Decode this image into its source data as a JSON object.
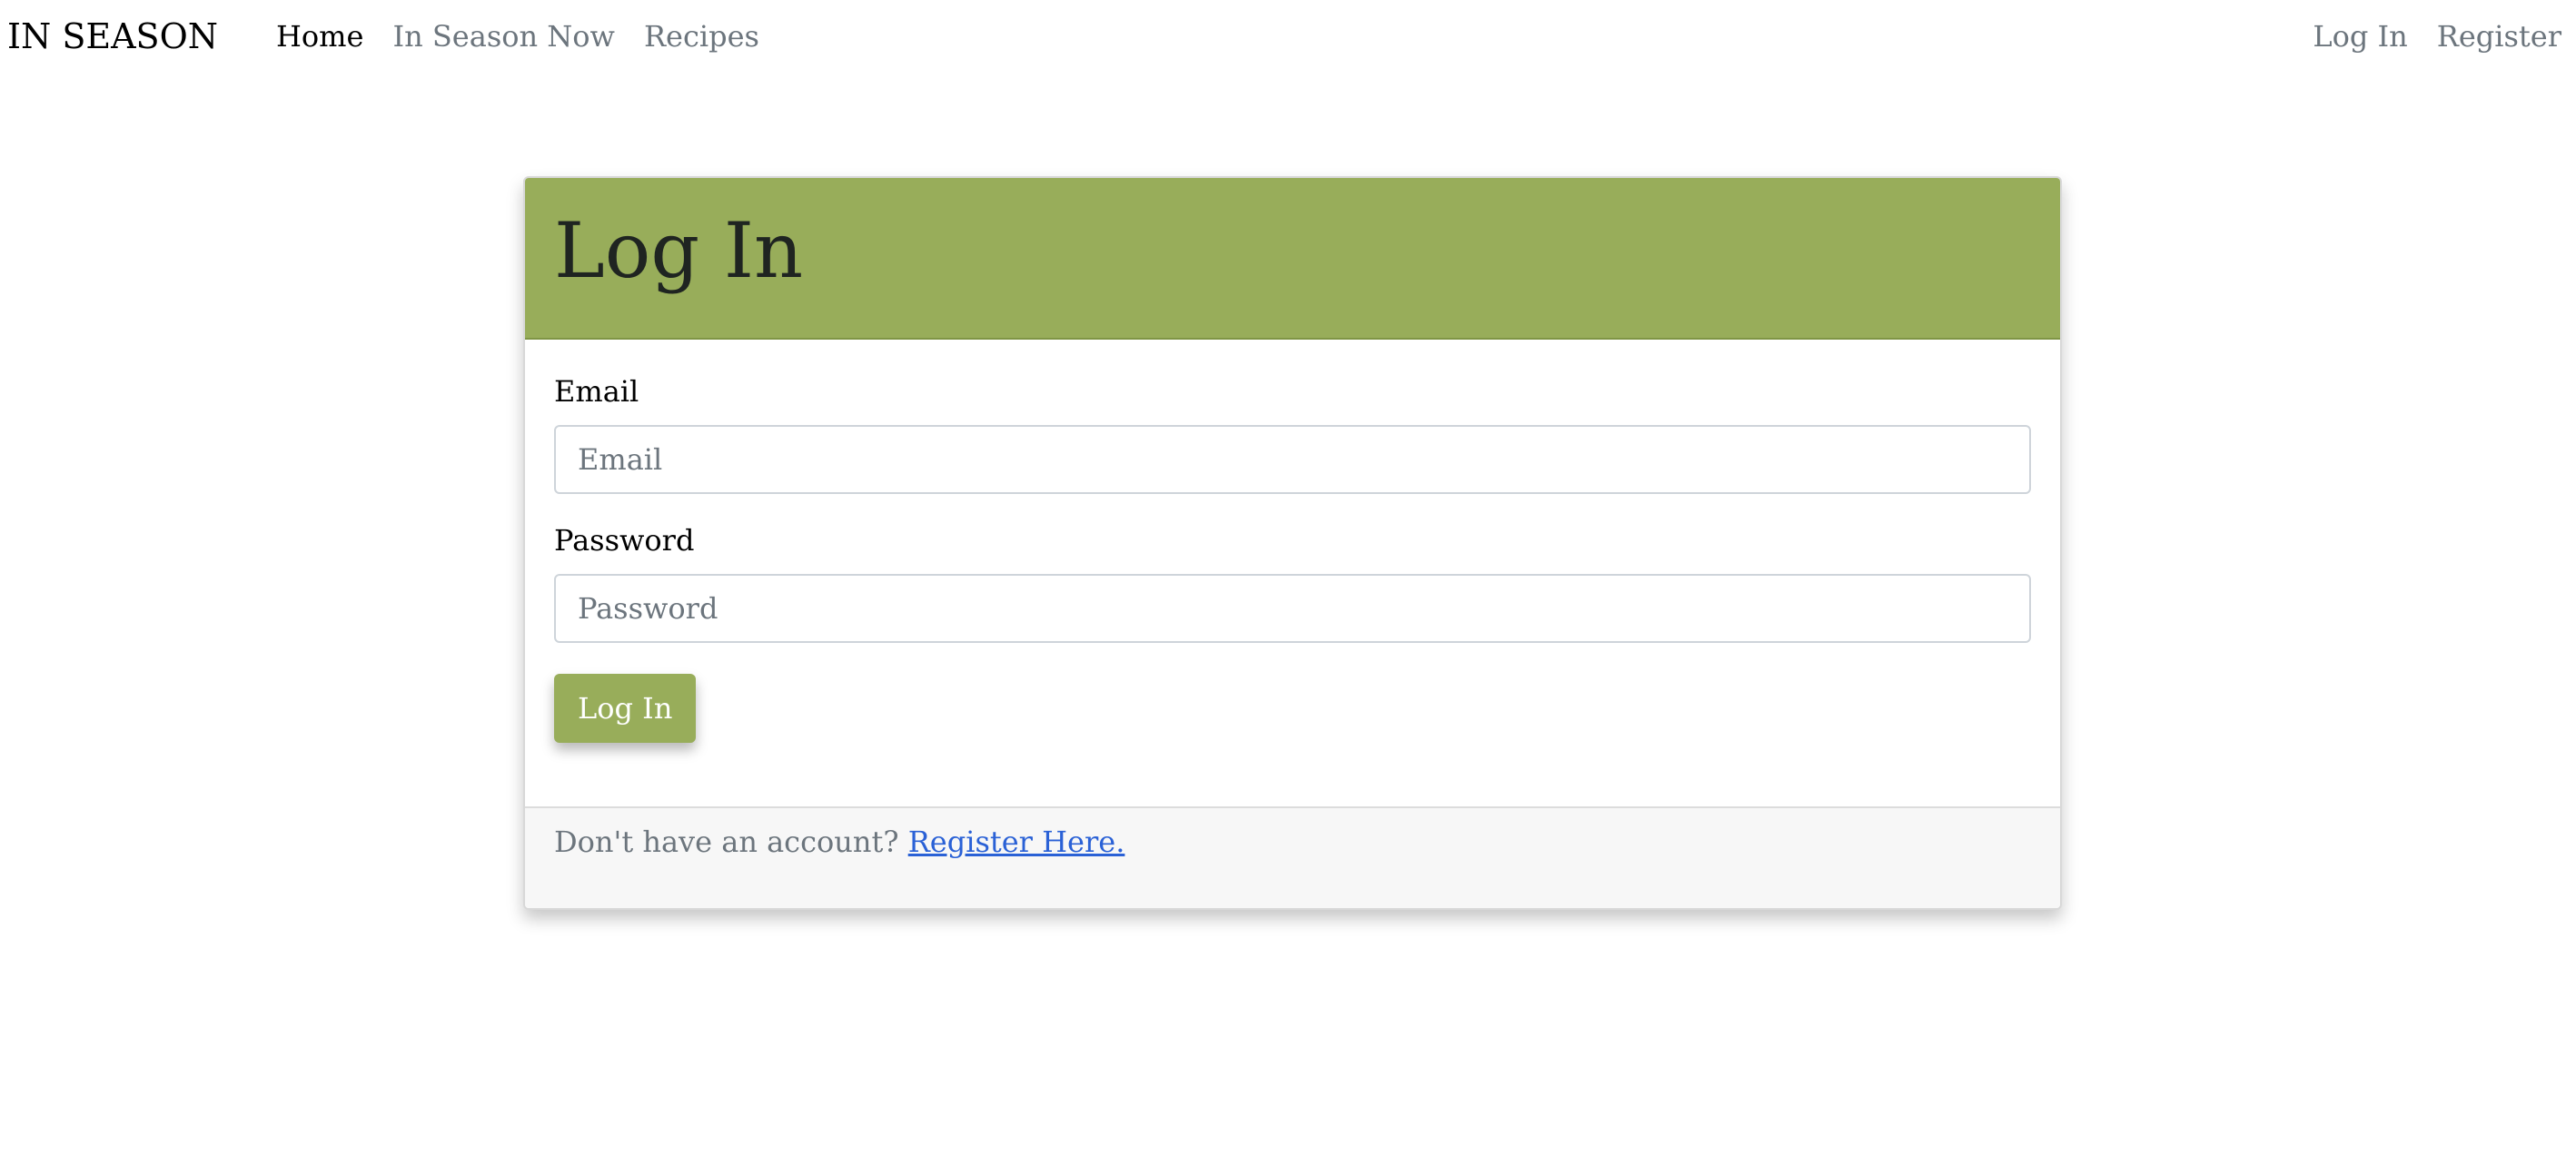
{
  "navbar": {
    "brand": "IN SEASON",
    "left_links": [
      {
        "label": "Home",
        "active": true
      },
      {
        "label": "In Season Now",
        "active": false
      },
      {
        "label": "Recipes",
        "active": false
      }
    ],
    "right_links": [
      {
        "label": "Log In"
      },
      {
        "label": "Register"
      }
    ]
  },
  "card": {
    "title": "Log In",
    "email": {
      "label": "Email",
      "placeholder": "Email",
      "value": ""
    },
    "password": {
      "label": "Password",
      "placeholder": "Password",
      "value": ""
    },
    "submit_label": "Log In",
    "footer": {
      "prompt": "Don't have an account? ",
      "link_label": "Register Here."
    }
  },
  "colors": {
    "accent_green": "#98ad5a",
    "link_blue": "#2a61d6",
    "muted_text": "#6c757d"
  }
}
